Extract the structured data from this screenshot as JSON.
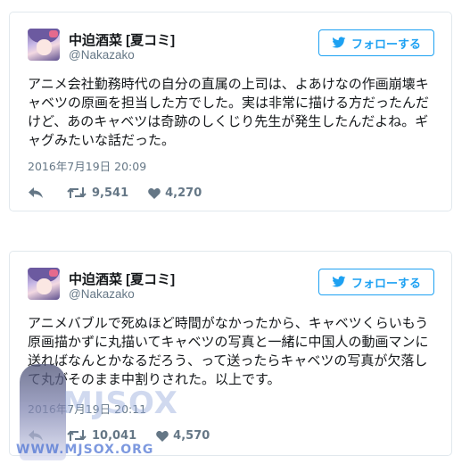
{
  "tweets": [
    {
      "author_name": "中迫酒菜 [夏コミ]",
      "author_handle": "@Nakazako",
      "follow_label": "フォローする",
      "text": "アニメ会社勤務時代の自分の直属の上司は、よあけなの作画崩壊キャベツの原画を担当した方でした。実は非常に描ける方だったんだけど、あのキャベツは奇跡のしくじり先生が発生したんだよね。ギャグみたいな話だった。",
      "date": "2016年7月19日 20:09",
      "retweets": "9,541",
      "likes": "4,270"
    },
    {
      "author_name": "中迫酒菜 [夏コミ]",
      "author_handle": "@Nakazako",
      "follow_label": "フォローする",
      "text": "アニメバブルで死ぬほど時間がなかったから、キャベツくらいもう原画描かずに丸描いてキャベツの写真と一緒に中国人の動画マンに送ればなんとかなるだろう、って送ったらキャベツの写真が欠落して丸がそのまま中割りされた。以上です。",
      "date": "2016年7月19日 20:11",
      "retweets": "10,041",
      "likes": "4,570"
    }
  ],
  "watermark": {
    "big_text": "MJSOX",
    "url_text": "WWW.MJSOX.ORG"
  },
  "colors": {
    "accent": "#1da1f2",
    "muted": "#657786",
    "border": "#e1e8ed"
  }
}
